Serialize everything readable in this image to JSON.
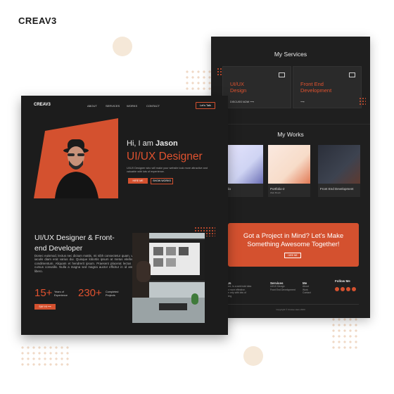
{
  "brand": {
    "logo_text": "CREAV3"
  },
  "back_page": {
    "services": {
      "title": "My Services",
      "items": [
        {
          "title_line1": "UI/UX",
          "title_line2": "Design",
          "cta": "DISCUSS NOW"
        },
        {
          "title_line1": "Front End",
          "title_line2": "Development",
          "cta": ""
        }
      ]
    },
    "works": {
      "title": "My Works",
      "items": [
        {
          "label": "rtfolio",
          "sub": ""
        },
        {
          "label": "Portfolio-2",
          "sub": "Web Brush"
        },
        {
          "label": "Front End Development",
          "sub": ""
        }
      ]
    },
    "cta": {
      "line1": "Got a Project in Mind? Let's Make",
      "line2": "Something Awesome Together!",
      "button": "HIRE ME"
    },
    "footer": {
      "col1": {
        "heading": "t Us",
        "lines": [
          "e text, is a web bold idea",
          "and more effective.",
          "hire only with lots of",
          "eeting"
        ]
      },
      "col2": {
        "heading": "Services",
        "lines": [
          "UI/UX Design",
          "Front End Development"
        ]
      },
      "col3": {
        "heading": "Me",
        "lines": [
          "About",
          "Work",
          "Contact"
        ]
      },
      "col4": {
        "heading": "Follow Me"
      },
      "copyright": "Copyright © Creave Here 2023"
    }
  },
  "front_page": {
    "nav": {
      "logo": "CREAV3",
      "items": [
        "ABOUT",
        "SERVICES",
        "WORKS",
        "CONTACT"
      ],
      "button": "Let's Talk"
    },
    "hero": {
      "greeting": "Hi, I am",
      "name": "Jason",
      "role": "UI/UX Designer",
      "description": "UI/UX Designer who will make your website look more attractive and valuable with lots of experience.",
      "hire_button": "HIRE ME",
      "work_button": "SHOW WORKS"
    },
    "about": {
      "title": "UI/UX Designer & Front-end Developer",
      "description": "Donec euismod, lectus nec dictum mattis, mi nibh consectetur quam, vel iaculis diam erat varius dui. Quisque lobortis ipsum at metus eleifend condimentum. Aliquam et hendrerit ipsum. Praesent placerat lectus id cursus convallis. Nulla a magna sed magna auctor efficitur in id amet libero.",
      "stats": [
        {
          "number": "15+",
          "label_line1": "Years of",
          "label_line2": "Experience"
        },
        {
          "number": "230+",
          "label_line1": "Completed",
          "label_line2": "Projects"
        }
      ],
      "button": "SAY HI"
    }
  },
  "colors": {
    "accent": "#d4512f",
    "page_bg": "#1c1c1c",
    "light_dots": "#f0d9c6"
  }
}
